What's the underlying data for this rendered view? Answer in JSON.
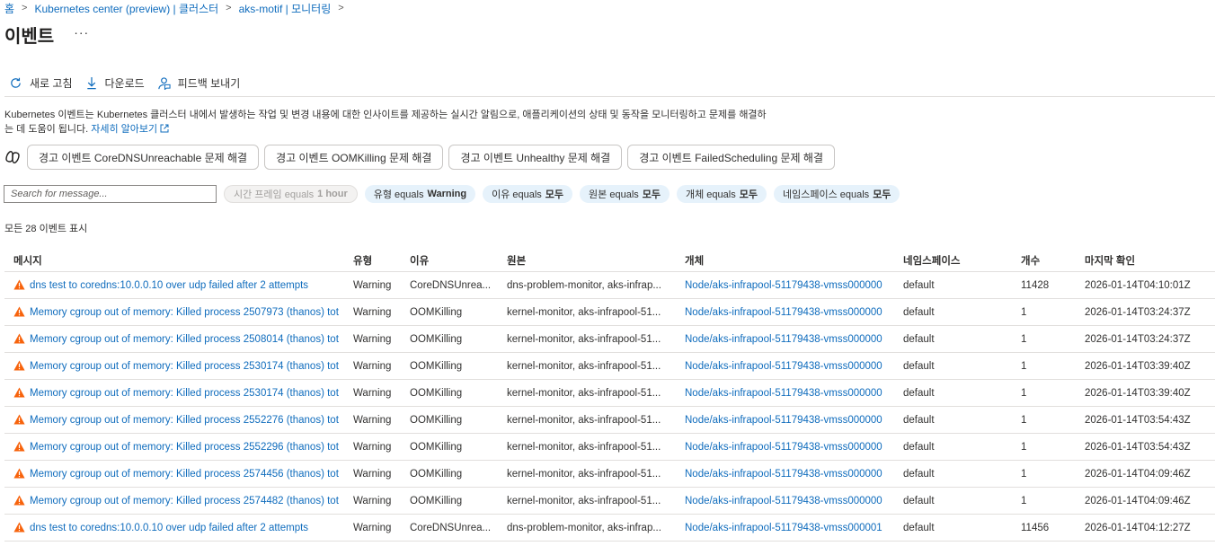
{
  "breadcrumb": [
    "홈",
    "Kubernetes center (preview) | 클러스터",
    "aks-motif | 모니터링"
  ],
  "page_title": "이벤트",
  "more_label": "···",
  "toolbar": {
    "refresh": "새로 고침",
    "download": "다운로드",
    "feedback": "피드백 보내기"
  },
  "description": {
    "line1": "Kubernetes 이벤트는 Kubernetes 클러스터 내에서 발생하는 작업 및 변경 내용에 대한 인사이트를 제공하는 실시간 알림으로, 애플리케이션의 상태 및 동작을 모니터링하고 문제를 해결하",
    "line2": "는 데 도움이 됩니다.",
    "learn_more": "자세히 알아보기"
  },
  "troubleshoot_buttons": [
    "경고 이벤트 CoreDNSUnreachable 문제 해결",
    "경고 이벤트 OOMKilling 문제 해결",
    "경고 이벤트 Unhealthy 문제 해결",
    "경고 이벤트 FailedScheduling 문제 해결"
  ],
  "search": {
    "placeholder": "Search for message..."
  },
  "filters": [
    {
      "label": "시간 프레임 equals",
      "value": "1 hour",
      "disabled": true
    },
    {
      "label": "유형 equals",
      "value": "Warning"
    },
    {
      "label": "이유 equals",
      "value": "모두"
    },
    {
      "label": "원본 equals",
      "value": "모두"
    },
    {
      "label": "개체 equals",
      "value": "모두"
    },
    {
      "label": "네임스페이스 equals",
      "value": "모두"
    }
  ],
  "count_text": "모든 28 이벤트 표시",
  "table": {
    "columns": [
      "메시지",
      "유형",
      "이유",
      "원본",
      "개체",
      "네임스페이스",
      "개수",
      "마지막 확인"
    ],
    "rows": [
      [
        "dns test to coredns:10.0.0.10 over udp failed after 2 attempts",
        "Warning",
        "CoreDNSUnrea...",
        "dns-problem-monitor, aks-infrap...",
        "Node/aks-infrapool-51179438-vmss000000",
        "default",
        "11428",
        "2026-01-14T04:10:01Z"
      ],
      [
        "Memory cgroup out of memory: Killed process 2507973 (thanos) tot",
        "Warning",
        "OOMKilling",
        "kernel-monitor, aks-infrapool-51...",
        "Node/aks-infrapool-51179438-vmss000000",
        "default",
        "1",
        "2026-01-14T03:24:37Z"
      ],
      [
        "Memory cgroup out of memory: Killed process 2508014 (thanos) tot",
        "Warning",
        "OOMKilling",
        "kernel-monitor, aks-infrapool-51...",
        "Node/aks-infrapool-51179438-vmss000000",
        "default",
        "1",
        "2026-01-14T03:24:37Z"
      ],
      [
        "Memory cgroup out of memory: Killed process 2530174 (thanos) tot",
        "Warning",
        "OOMKilling",
        "kernel-monitor, aks-infrapool-51...",
        "Node/aks-infrapool-51179438-vmss000000",
        "default",
        "1",
        "2026-01-14T03:39:40Z"
      ],
      [
        "Memory cgroup out of memory: Killed process 2530174 (thanos) tot",
        "Warning",
        "OOMKilling",
        "kernel-monitor, aks-infrapool-51...",
        "Node/aks-infrapool-51179438-vmss000000",
        "default",
        "1",
        "2026-01-14T03:39:40Z"
      ],
      [
        "Memory cgroup out of memory: Killed process 2552276 (thanos) tot",
        "Warning",
        "OOMKilling",
        "kernel-monitor, aks-infrapool-51...",
        "Node/aks-infrapool-51179438-vmss000000",
        "default",
        "1",
        "2026-01-14T03:54:43Z"
      ],
      [
        "Memory cgroup out of memory: Killed process 2552296 (thanos) tot",
        "Warning",
        "OOMKilling",
        "kernel-monitor, aks-infrapool-51...",
        "Node/aks-infrapool-51179438-vmss000000",
        "default",
        "1",
        "2026-01-14T03:54:43Z"
      ],
      [
        "Memory cgroup out of memory: Killed process 2574456 (thanos) tot",
        "Warning",
        "OOMKilling",
        "kernel-monitor, aks-infrapool-51...",
        "Node/aks-infrapool-51179438-vmss000000",
        "default",
        "1",
        "2026-01-14T04:09:46Z"
      ],
      [
        "Memory cgroup out of memory: Killed process 2574482 (thanos) tot",
        "Warning",
        "OOMKilling",
        "kernel-monitor, aks-infrapool-51...",
        "Node/aks-infrapool-51179438-vmss000000",
        "default",
        "1",
        "2026-01-14T04:09:46Z"
      ],
      [
        "dns test to coredns:10.0.0.10 over udp failed after 2 attempts",
        "Warning",
        "CoreDNSUnrea...",
        "dns-problem-monitor, aks-infrap...",
        "Node/aks-infrapool-51179438-vmss000001",
        "default",
        "11456",
        "2026-01-14T04:12:27Z"
      ]
    ]
  },
  "colors": {
    "link": "#0f6cbd",
    "warning": "#f7630c",
    "pill": "#e6f2fb"
  },
  "icons": {
    "refresh": "refresh-icon",
    "download": "download-icon",
    "feedback": "feedback-icon",
    "warning": "warning-icon",
    "copilot": "copilot-icon",
    "external": "external-link-icon"
  }
}
